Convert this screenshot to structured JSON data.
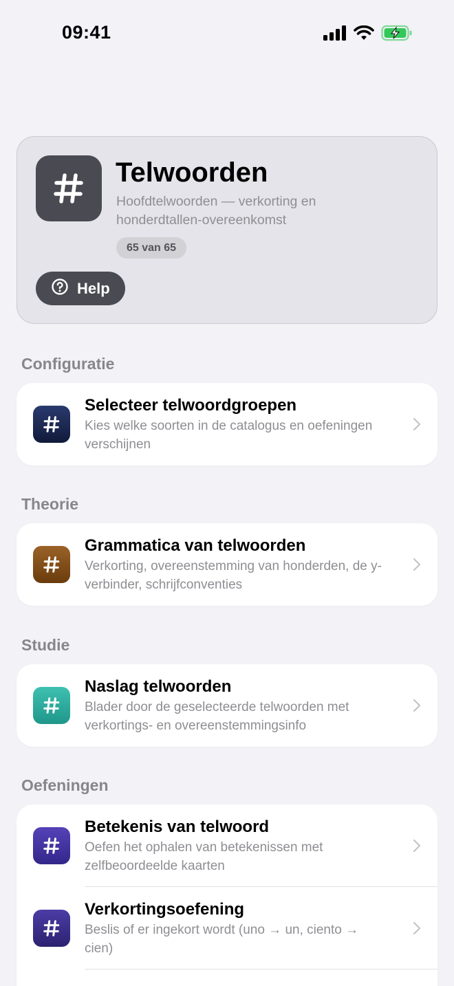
{
  "status_bar": {
    "time": "09:41"
  },
  "header": {
    "icon_glyph": "#",
    "title": "Telwoorden",
    "subtitle": "Hoofdtelwoorden — verkorting en honderdtallen-overeenkomst",
    "progress": "65 van 65",
    "help_label": "Help"
  },
  "sections": {
    "configuratie": {
      "title": "Configuratie",
      "rows": [
        {
          "glyph": "#",
          "title": "Selecteer telwoordgroepen",
          "subtitle": "Kies welke soorten in de catalogus en oefeningen verschijnen",
          "color": "#1c2a55"
        }
      ]
    },
    "theorie": {
      "title": "Theorie",
      "rows": [
        {
          "glyph": "#",
          "title": "Grammatica van telwoorden",
          "subtitle": "Verkorting, overeenstemming van honderden, de y-verbinder, schrijfconventies",
          "color": "#7a4a14"
        }
      ]
    },
    "studie": {
      "title": "Studie",
      "rows": [
        {
          "glyph": "#",
          "title": "Naslag telwoorden",
          "subtitle": "Blader door de geselecteerde telwoorden met verkortings- en overeenstemmingsinfo",
          "color": "#2aa597"
        }
      ]
    },
    "oefeningen": {
      "title": "Oefeningen",
      "rows": [
        {
          "glyph": "#",
          "title": "Betekenis van telwoord",
          "subtitle": "Oefen het ophalen van betekenissen met zelfbeoordeelde kaarten",
          "color": "#3d2f94"
        },
        {
          "glyph": "#",
          "title": "Verkortingsoefening",
          "subtitle": "Beslis of er ingekort wordt (uno → un, ciento → cien)",
          "color": "#3a2d85"
        }
      ]
    }
  }
}
